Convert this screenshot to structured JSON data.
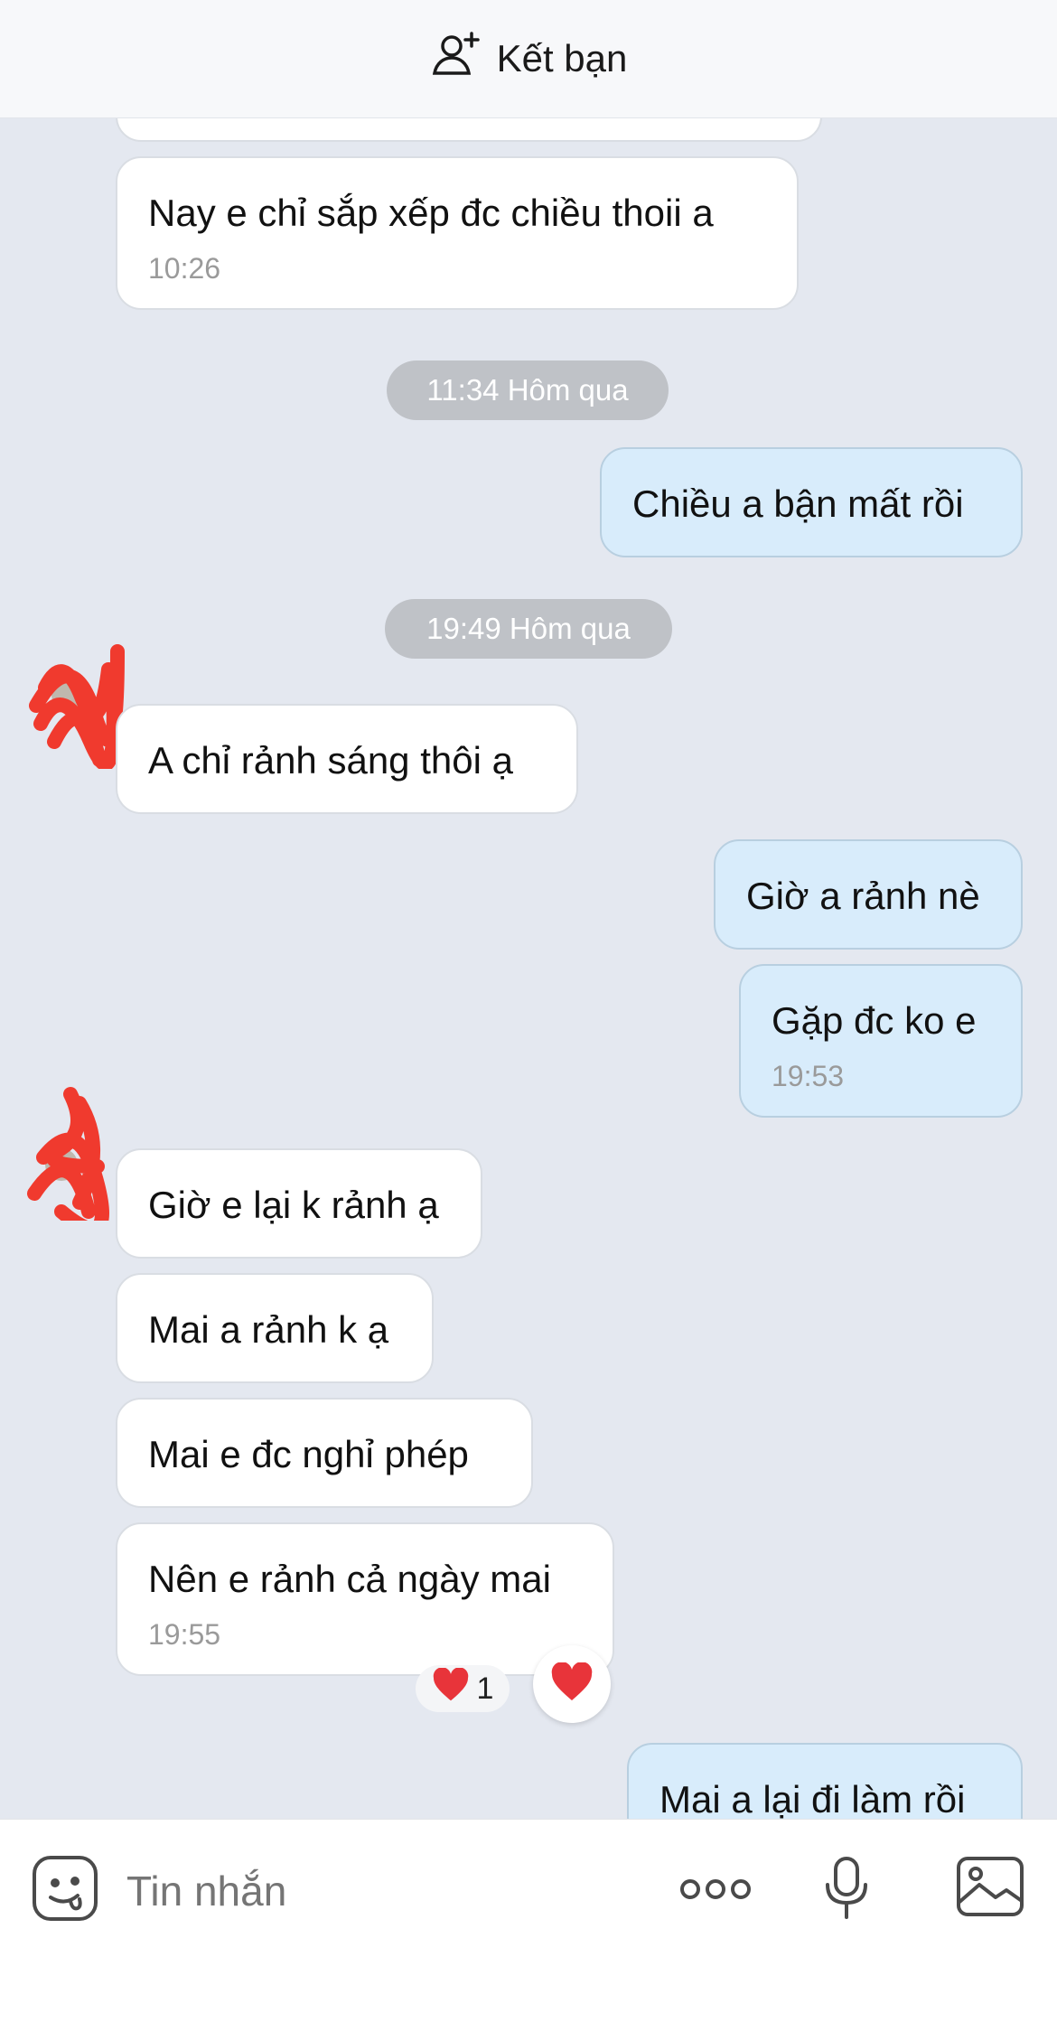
{
  "header": {
    "add_friend_label": "Kết bạn"
  },
  "messages": [
    {
      "text": "Nay e chỉ sắp xếp đc chiều thoii a",
      "time": "10:26"
    },
    {
      "text": "Chiều a bận mất rồi"
    },
    {
      "text": "A chỉ rảnh sáng thôi ạ"
    },
    {
      "text": "Giờ a rảnh nè"
    },
    {
      "text": "Gặp đc ko e",
      "time": "19:53"
    },
    {
      "text": "Giờ e lại k rảnh ạ"
    },
    {
      "text": "Mai a rảnh k ạ"
    },
    {
      "text": "Mai e đc nghỉ phép"
    },
    {
      "text": "Nên e rảnh cả ngày mai",
      "time": "19:55"
    },
    {
      "text": "Mai a lại đi làm rồi"
    }
  ],
  "dividers": [
    "11:34 Hôm qua",
    "19:49 Hôm qua"
  ],
  "reaction": {
    "count": "1"
  },
  "composer": {
    "placeholder": "Tin nhắn"
  },
  "colors": {
    "incoming_bubble": "#ffffff",
    "outgoing_bubble": "#d8ecfb",
    "background": "#e4e8f0"
  }
}
